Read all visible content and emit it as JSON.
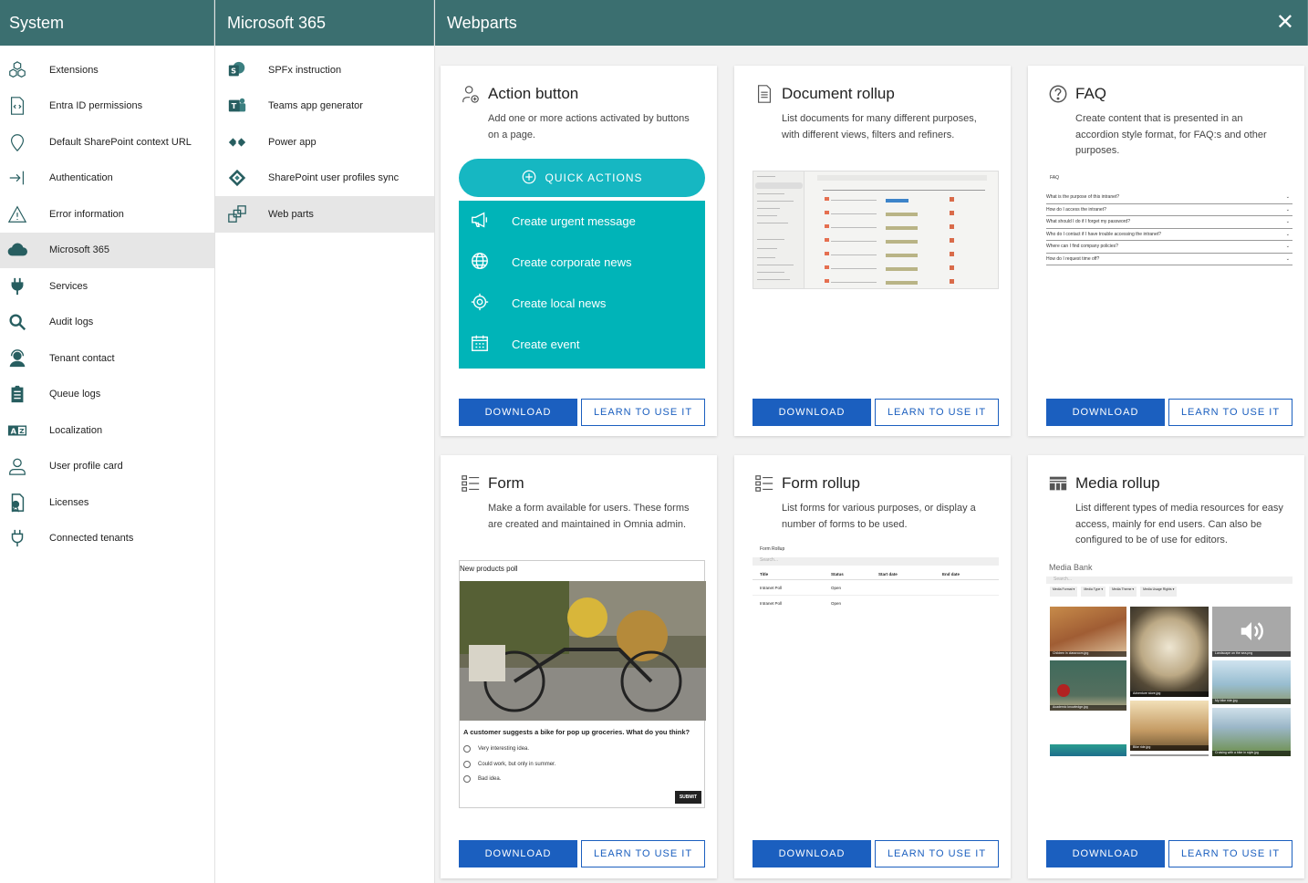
{
  "system": {
    "title": "System",
    "items": [
      {
        "label": "Extensions",
        "icon": "cubes-icon"
      },
      {
        "label": "Entra ID permissions",
        "icon": "code-file-icon"
      },
      {
        "label": "Default SharePoint context URL",
        "icon": "map-pin-icon"
      },
      {
        "label": "Authentication",
        "icon": "sign-in-icon"
      },
      {
        "label": "Error information",
        "icon": "warning-icon"
      },
      {
        "label": "Microsoft 365",
        "icon": "cloud-icon"
      },
      {
        "label": "Services",
        "icon": "plug-icon"
      },
      {
        "label": "Audit logs",
        "icon": "search-icon"
      },
      {
        "label": "Tenant contact",
        "icon": "headset-icon"
      },
      {
        "label": "Queue logs",
        "icon": "clipboard-list-icon"
      },
      {
        "label": "Localization",
        "icon": "translate-icon"
      },
      {
        "label": "User profile card",
        "icon": "user-icon"
      },
      {
        "label": "Licenses",
        "icon": "license-icon"
      },
      {
        "label": "Connected tenants",
        "icon": "plug-outline-icon"
      }
    ],
    "active_index": 5
  },
  "m365": {
    "title": "Microsoft 365",
    "items": [
      {
        "label": "SPFx instruction",
        "icon": "sharepoint-icon"
      },
      {
        "label": "Teams app generator",
        "icon": "teams-icon"
      },
      {
        "label": "Power app",
        "icon": "power-apps-icon"
      },
      {
        "label": "SharePoint user profiles sync",
        "icon": "sync-icon"
      },
      {
        "label": "Web parts",
        "icon": "web-parts-icon"
      }
    ],
    "active_index": 4
  },
  "webparts": {
    "title": "Webparts",
    "close_label": "✕",
    "download_label": "DOWNLOAD",
    "learn_label": "LEARN TO USE IT",
    "cards": [
      {
        "title": "Action button",
        "desc": "Add one or more actions activated by buttons on a page.",
        "icon": "action-button-icon"
      },
      {
        "title": "Document rollup",
        "desc": "List documents for many different purposes, with different views, filters and refiners.",
        "icon": "document-icon"
      },
      {
        "title": "FAQ",
        "desc": "Create content that is presented in an accordion style format, for FAQ:s and other purposes.",
        "icon": "question-circle-icon"
      },
      {
        "title": "Form",
        "desc": "Make a form available for users. These forms are created and maintained in Omnia admin.",
        "icon": "form-icon"
      },
      {
        "title": "Form rollup",
        "desc": "List forms for various purposes, or display a number of forms to be used.",
        "icon": "form-rollup-icon"
      },
      {
        "title": "Media rollup",
        "desc": "List different types of media resources for easy access, mainly for end users. Can also be configured to be of use for editors.",
        "icon": "media-grid-icon"
      }
    ]
  },
  "quick_actions": {
    "header": "QUICK ACTIONS",
    "items": [
      {
        "label": "Create urgent message",
        "icon": "megaphone-icon"
      },
      {
        "label": "Create corporate news",
        "icon": "globe-icon"
      },
      {
        "label": "Create local news",
        "icon": "crosshair-icon"
      },
      {
        "label": "Create event",
        "icon": "calendar-icon"
      }
    ]
  },
  "faq_preview": {
    "title": "FAQ",
    "questions": [
      "What is the purpose of this intranet?",
      "How do I access the intranet?",
      "What should I do if I forget my password?",
      "Who do I contact if I have trouble accessing the intranet?",
      "Where can I find company policies?",
      "How do I request time off?"
    ]
  },
  "form_preview": {
    "title": "New products poll",
    "question": "A customer suggests a bike for pop up groceries. What do you think?",
    "options": [
      "Very interesting idea.",
      "Could work, but only in summer.",
      "Bad idea."
    ],
    "submit": "SUBMIT"
  },
  "form_rollup_preview": {
    "title": "Form Rollup",
    "search": "Search...",
    "columns": [
      "Title",
      "Status",
      "Start date",
      "End date"
    ],
    "rows": [
      [
        "Intranet Poll",
        "Open"
      ],
      [
        "Intranet Poll",
        "Open"
      ]
    ]
  },
  "media_preview": {
    "title": "Media Bank",
    "search": "Search...",
    "filters": [
      "Media Format ▾",
      "Media Type ▾",
      "Media Theme ▾",
      "Media Usage Rights ▾"
    ],
    "captions": [
      "Children in classroom.jpg",
      "Adventure store.jpg",
      "Landscape on the sea.png",
      "Academic knowledge.jpg",
      "Bike ride.jpg",
      "My bike ride.jpg",
      "Cruising with a bike in style.jpg"
    ]
  },
  "colors": {
    "header": "#3b6f70",
    "accent": "#1b5fbf",
    "quick_actions": "#00b4b8",
    "icon": "#275e60"
  }
}
